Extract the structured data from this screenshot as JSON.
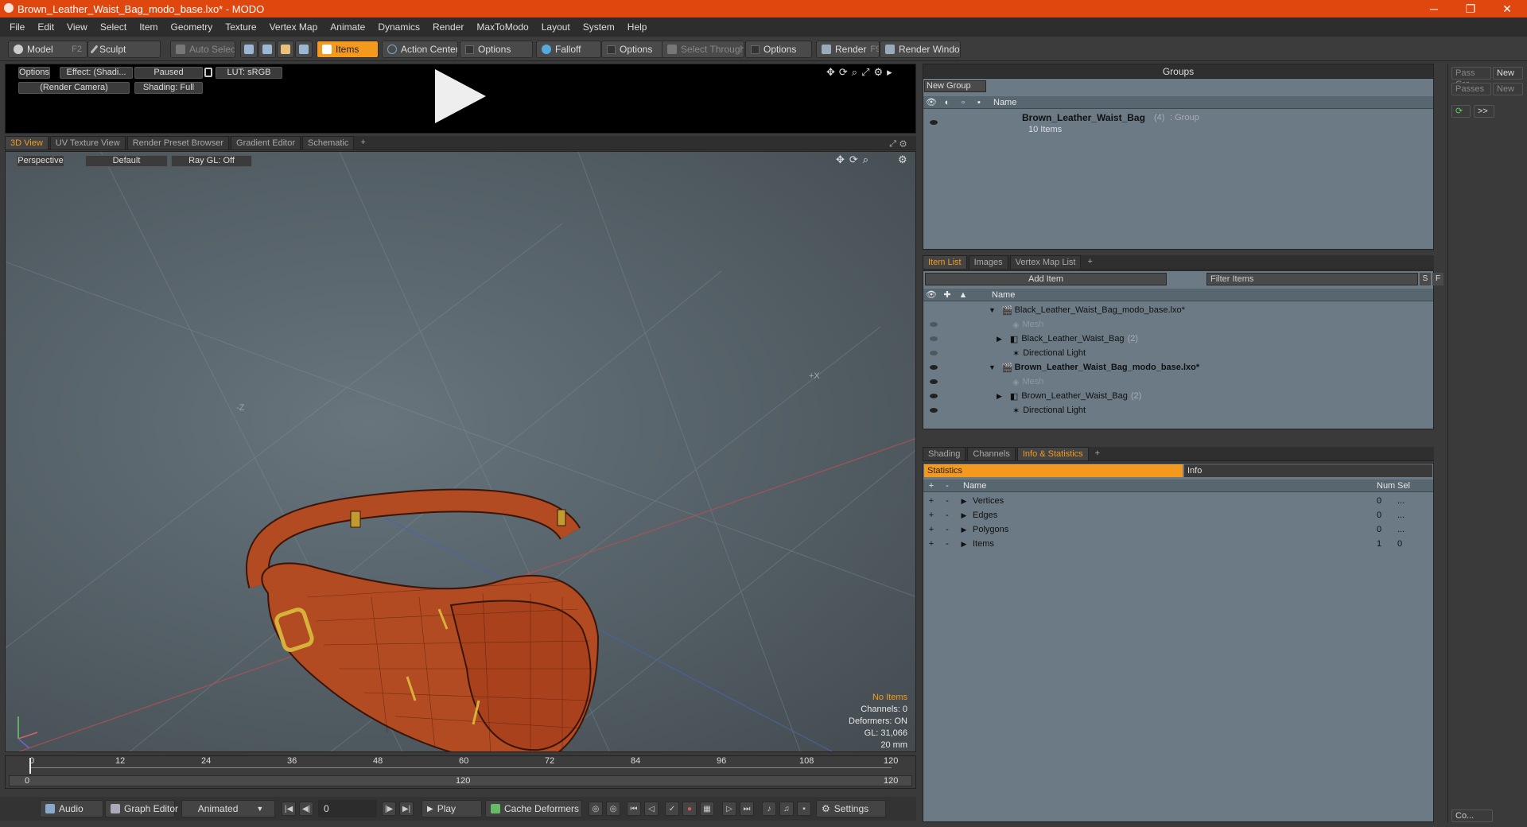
{
  "window": {
    "title": "Brown_Leather_Waist_Bag_modo_base.lxo* - MODO",
    "minimize": "─",
    "maximize": "❐",
    "close": "✕"
  },
  "menu": [
    "File",
    "Edit",
    "View",
    "Select",
    "Item",
    "Geometry",
    "Texture",
    "Vertex Map",
    "Animate",
    "Dynamics",
    "Render",
    "MaxToModo",
    "Layout",
    "System",
    "Help"
  ],
  "toolbar": {
    "model": "Model",
    "model_key": "F2",
    "sculpt": "Sculpt",
    "auto_select": "Auto Select",
    "items": "Items",
    "action_center": "Action Center",
    "options1": "Options",
    "falloff": "Falloff",
    "options2": "Options",
    "select_through": "Select Through",
    "options3": "Options",
    "render": "Render",
    "render_key": "F9",
    "render_window": "Render Window"
  },
  "preview": {
    "options": "Options",
    "effect": "Effect: (Shadi...",
    "paused": "Paused",
    "lut": "LUT: sRGB",
    "camera": "(Render Camera)",
    "shading": "Shading: Full"
  },
  "view_tabs": [
    "3D View",
    "UV Texture View",
    "Render Preset Browser",
    "Gradient Editor",
    "Schematic",
    "+"
  ],
  "viewport": {
    "perspective": "Perspective",
    "default": "Default",
    "raygl": "Ray GL: Off",
    "axis_x": "+X",
    "axis_z": "-Z",
    "info": {
      "no_items": "No Items",
      "channels": "Channels: 0",
      "deformers": "Deformers: ON",
      "gl": "GL: 31,066",
      "scale": "20 mm"
    }
  },
  "timeline": {
    "ticks": [
      "0",
      "12",
      "24",
      "36",
      "48",
      "60",
      "72",
      "84",
      "96",
      "108",
      "120"
    ],
    "range": [
      "0",
      "120",
      "120"
    ]
  },
  "transport": {
    "audio": "Audio",
    "graph_editor": "Graph Editor",
    "animated": "Animated",
    "frame": "0",
    "play": "Play",
    "cache": "Cache Deformers",
    "settings": "Settings"
  },
  "groups": {
    "title": "Groups",
    "new_group": "New Group",
    "col_name": "Name",
    "item": {
      "name": "Brown_Leather_Waist_Bag",
      "count": "(4)",
      "type": ": Group",
      "sub": "10 Items"
    }
  },
  "far_right": {
    "pass_groups": "Pass Gro",
    "new1": "New",
    "passes": "Passes",
    "new2": "New",
    "arrows": ">>",
    "co": "Co..."
  },
  "item_list": {
    "tabs": [
      "Item List",
      "Images",
      "Vertex Map List",
      "+"
    ],
    "add_item": "Add Item",
    "filter": "Filter Items",
    "s": "S",
    "f": "F",
    "col_name": "Name",
    "rows": [
      {
        "label": "Black_Leather_Waist_Bag_modo_base.lxo*",
        "bold": false
      },
      {
        "label": "Mesh",
        "bold": false
      },
      {
        "label": "Black_Leather_Waist_Bag",
        "count": "(2)",
        "bold": false
      },
      {
        "label": "Directional Light",
        "bold": false
      },
      {
        "label": "Brown_Leather_Waist_Bag_modo_base.lxo*",
        "bold": true
      },
      {
        "label": "Mesh",
        "bold": false
      },
      {
        "label": "Brown_Leather_Waist_Bag",
        "count": "(2)",
        "bold": false
      },
      {
        "label": "Directional Light",
        "bold": false
      }
    ]
  },
  "stats": {
    "tabs": [
      "Shading",
      "Channels",
      "Info & Statistics",
      "+"
    ],
    "statistics": "Statistics",
    "info": "Info",
    "cols": {
      "name": "Name",
      "num": "Num",
      "sel": "Sel"
    },
    "rows": [
      {
        "name": "Vertices",
        "num": "0",
        "sel": "..."
      },
      {
        "name": "Edges",
        "num": "0",
        "sel": "..."
      },
      {
        "name": "Polygons",
        "num": "0",
        "sel": "..."
      },
      {
        "name": "Items",
        "num": "1",
        "sel": "0"
      }
    ],
    "plus": "+",
    "minus": "-"
  },
  "colors": {
    "accent": "#f39a1e",
    "titlebar": "#e0470f",
    "bag": "#b24a22"
  }
}
